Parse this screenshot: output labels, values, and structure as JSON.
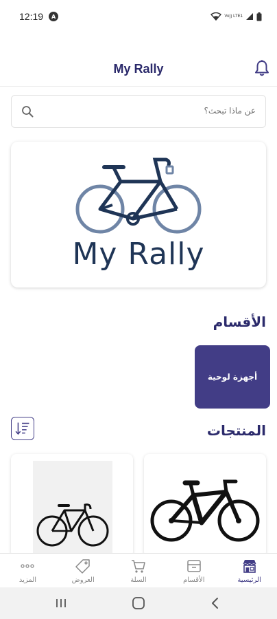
{
  "status": {
    "time": "12:19",
    "network": "Vo)) LTE1"
  },
  "app_bar": {
    "title": "My Rally"
  },
  "search": {
    "placeholder": "عن ماذا تبحث؟"
  },
  "banner": {
    "logo_text": "My Rally"
  },
  "categories": {
    "title": "الأقسام",
    "items": [
      {
        "label": "أجهزة لوحية"
      }
    ]
  },
  "products": {
    "title": "المنتجات"
  },
  "bottom_nav": {
    "items": [
      {
        "label": "الرئيسية",
        "icon": "store-icon",
        "active": true
      },
      {
        "label": "الأقسام",
        "icon": "box-icon",
        "active": false
      },
      {
        "label": "السلة",
        "icon": "cart-icon",
        "active": false
      },
      {
        "label": "العروض",
        "icon": "tag-icon",
        "active": false
      },
      {
        "label": "المزيد",
        "icon": "more-icon",
        "active": false
      }
    ]
  },
  "colors": {
    "primary": "#423d86",
    "title": "#2b2a6b",
    "logo": "#1f3556",
    "wheel": "#6f85a6"
  }
}
